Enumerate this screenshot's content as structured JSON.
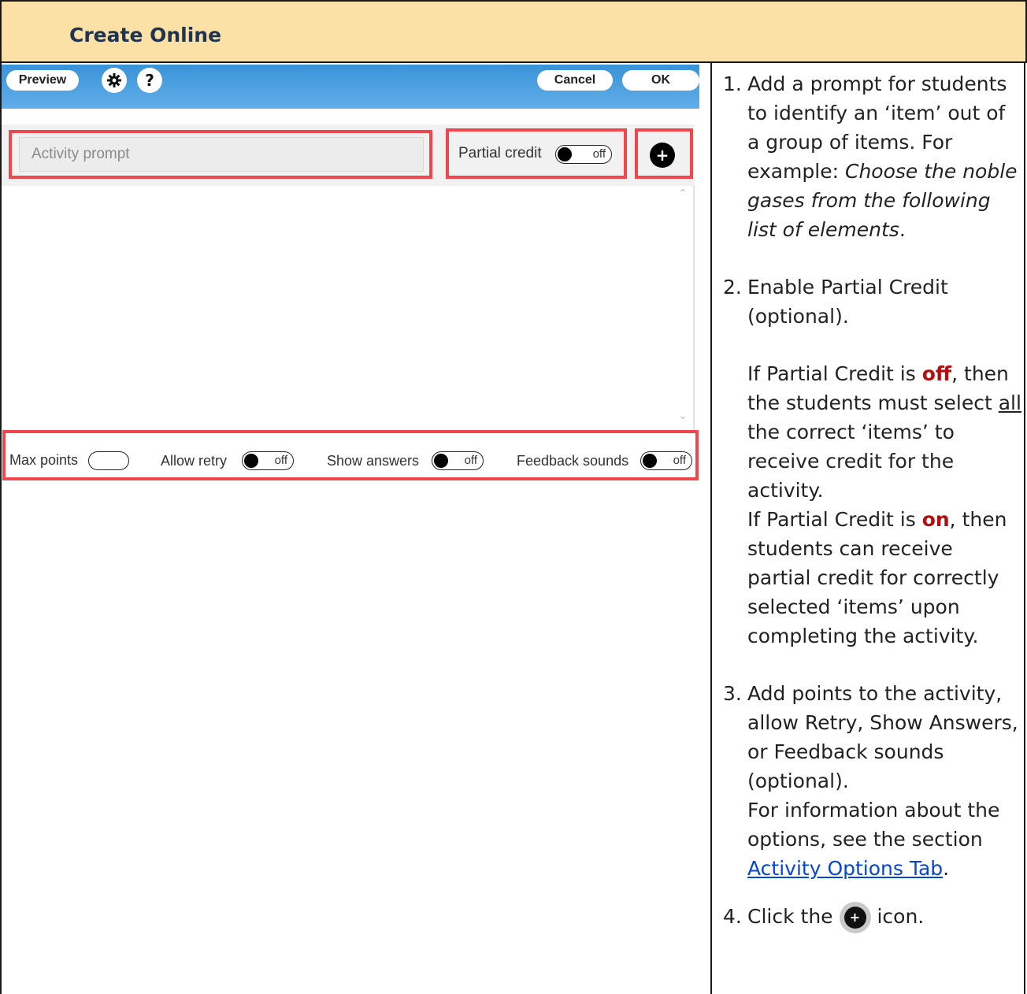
{
  "header": {
    "title": "Create Online"
  },
  "toolbar": {
    "preview_label": "Preview",
    "settings_icon": "gear-icon",
    "help_label": "?",
    "cancel_label": "Cancel",
    "ok_label": "OK"
  },
  "editor": {
    "prompt_placeholder": "Activity prompt",
    "partial_credit_label": "Partial credit",
    "partial_credit_state": "off",
    "add_icon": "+"
  },
  "options": {
    "max_points_label": "Max points",
    "allow_retry_label": "Allow retry",
    "allow_retry_state": "off",
    "show_answers_label": "Show answers",
    "show_answers_state": "off",
    "feedback_sounds_label": "Feedback sounds",
    "feedback_sounds_state": "off"
  },
  "instructions": {
    "step1_num": "1.",
    "step1_text": "Add a prompt for students to identify an ‘item’ out of a group of items. For example:",
    "step1_example": "Choose the noble gases from the following list of elements",
    "step1_end": ".",
    "step2_num": "2.",
    "step2_text": "Enable Partial Credit (optional).",
    "step2_off_a": "If Partial Credit is ",
    "step2_off_kw": "off",
    "step2_off_b": ", then the students must select ",
    "step2_off_all": "all",
    "step2_off_c": " the correct ‘items’ to receive credit for the activity.",
    "step2_on_a": "If Partial Credit is ",
    "step2_on_kw": "on",
    "step2_on_b": ", then students can receive partial credit for correctly selected ‘items’ upon completing the activity.",
    "step3_num": "3.",
    "step3_text": "Add points to the activity, allow Retry, Show Answers, or Feedback sounds (optional).",
    "step3_info": "For information about the options, see the section ",
    "step3_link": "Activity Options Tab",
    "step3_end": ".",
    "step4_num": "4.",
    "step4_a": "Click the",
    "step4_icon": "+",
    "step4_b": "icon."
  },
  "colors": {
    "header_bg": "#fbe1a6",
    "header_text": "#1f3450",
    "toolbar_blue": "#3a93d8",
    "highlight_red": "#f0474f",
    "keyword_red": "#b50e0e",
    "link_blue": "#0645d6"
  }
}
